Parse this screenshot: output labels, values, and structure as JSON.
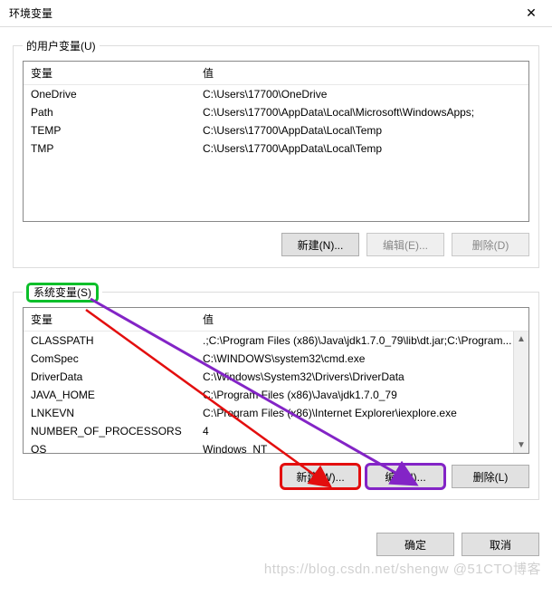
{
  "window": {
    "title": "环境变量",
    "close_glyph": "✕"
  },
  "user_vars": {
    "legend": "      的用户变量(U)",
    "col_var": "变量",
    "col_val": "值",
    "rows": [
      {
        "name": "OneDrive",
        "value": "C:\\Users\\17700\\OneDrive"
      },
      {
        "name": "Path",
        "value": "C:\\Users\\17700\\AppData\\Local\\Microsoft\\WindowsApps;"
      },
      {
        "name": "TEMP",
        "value": "C:\\Users\\17700\\AppData\\Local\\Temp"
      },
      {
        "name": "TMP",
        "value": "C:\\Users\\17700\\AppData\\Local\\Temp"
      }
    ],
    "btn_new": "新建(N)...",
    "btn_edit": "编辑(E)...",
    "btn_del": "删除(D)"
  },
  "sys_vars": {
    "legend": "系统变量(S)",
    "col_var": "变量",
    "col_val": "值",
    "rows": [
      {
        "name": "CLASSPATH",
        "value": ".;C:\\Program Files (x86)\\Java\\jdk1.7.0_79\\lib\\dt.jar;C:\\Program..."
      },
      {
        "name": "ComSpec",
        "value": "C:\\WINDOWS\\system32\\cmd.exe"
      },
      {
        "name": "DriverData",
        "value": "C:\\Windows\\System32\\Drivers\\DriverData"
      },
      {
        "name": "JAVA_HOME",
        "value": "C:\\Program Files (x86)\\Java\\jdk1.7.0_79"
      },
      {
        "name": "LNKEVN",
        "value": "C:\\Program Files (x86)\\Internet Explorer\\iexplore.exe"
      },
      {
        "name": "NUMBER_OF_PROCESSORS",
        "value": "4"
      },
      {
        "name": "OS",
        "value": "Windows_NT"
      }
    ],
    "btn_new": "新建(W)...",
    "btn_edit": "编辑(I)...",
    "btn_del": "删除(L)"
  },
  "footer": {
    "btn_ok": "确定",
    "btn_cancel": "取消"
  },
  "watermark": "https://blog.csdn.net/shengw  @51CTO博客"
}
